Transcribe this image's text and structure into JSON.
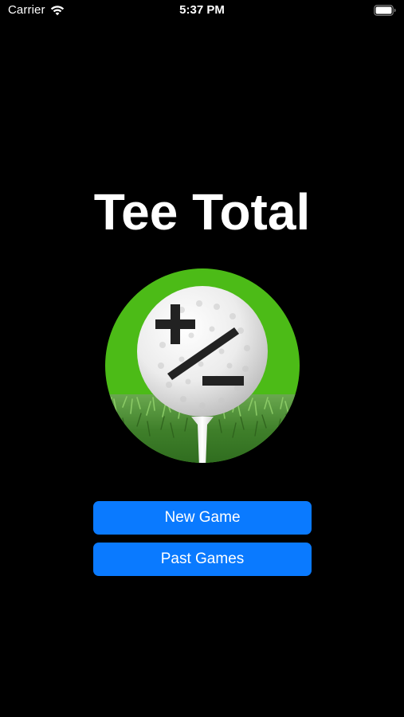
{
  "status_bar": {
    "carrier": "Carrier",
    "time": "5:37 PM",
    "wifi_icon": "wifi-icon",
    "battery_icon": "battery-icon"
  },
  "app": {
    "title": "Tee Total",
    "logo_icon": "golf-ball-plus-minus-icon"
  },
  "buttons": {
    "new_game": "New Game",
    "past_games": "Past Games"
  },
  "colors": {
    "background": "#000000",
    "button": "#0a7aff",
    "logo_green": "#4cbb17"
  }
}
